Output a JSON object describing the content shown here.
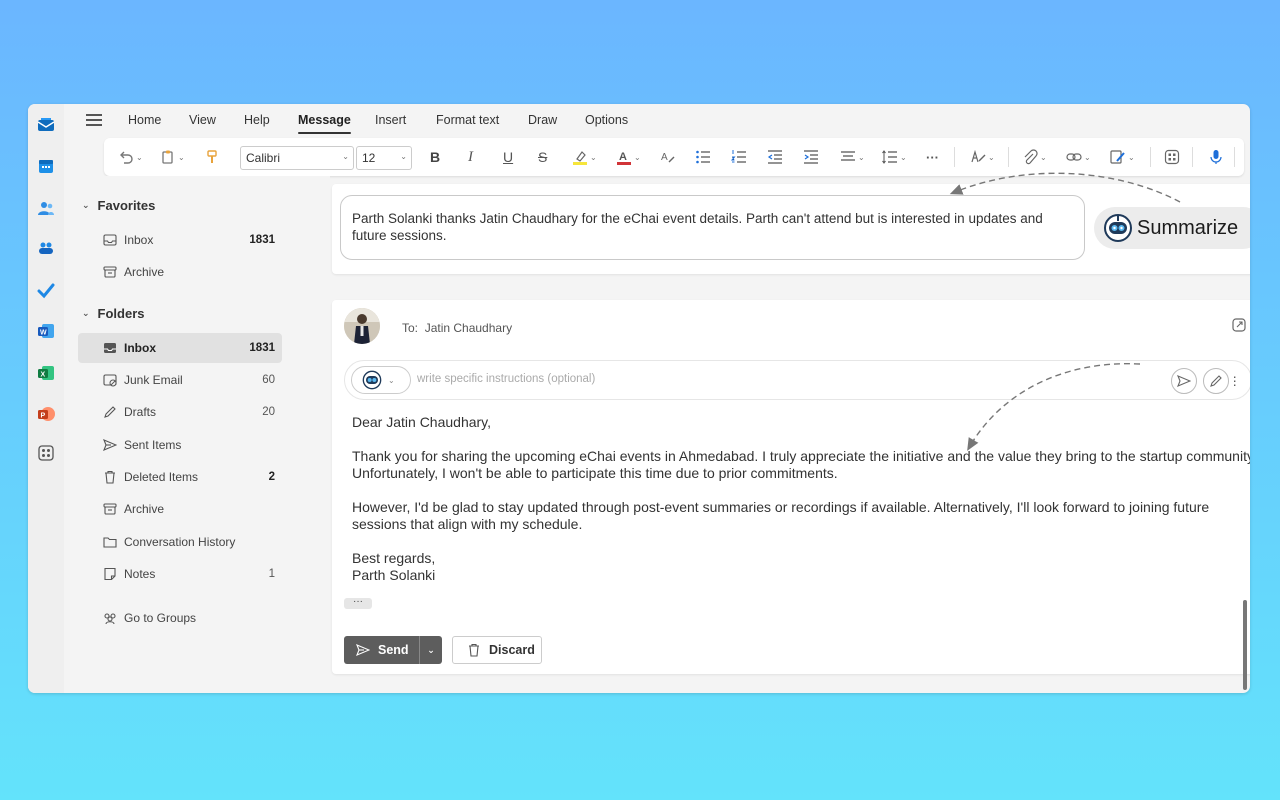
{
  "menu": {
    "tabs": [
      "Home",
      "View",
      "Help",
      "Message",
      "Insert",
      "Format text",
      "Draw",
      "Options"
    ],
    "active_tab": "Message"
  },
  "ribbon": {
    "font_name": "Calibri",
    "font_size": "12",
    "bold": "B",
    "italic": "I",
    "underline": "U",
    "strikethrough": "S",
    "more": "···"
  },
  "nav": {
    "favorites_label": "Favorites",
    "favorites": [
      {
        "label": "Inbox",
        "count": "1831",
        "icon": "inbox-icon"
      },
      {
        "label": "Archive",
        "count": "",
        "icon": "archive-icon"
      }
    ],
    "folders_label": "Folders",
    "folders": [
      {
        "label": "Inbox",
        "count": "1831",
        "icon": "inbox-icon",
        "selected": true
      },
      {
        "label": "Junk Email",
        "count": "60",
        "icon": "junk-icon"
      },
      {
        "label": "Drafts",
        "count": "20",
        "icon": "drafts-icon"
      },
      {
        "label": "Sent Items",
        "count": "",
        "icon": "send-icon"
      },
      {
        "label": "Deleted Items",
        "count": "2",
        "icon": "trash-icon"
      },
      {
        "label": "Archive",
        "count": "",
        "icon": "archive-icon"
      },
      {
        "label": "Conversation History",
        "count": "",
        "icon": "folder-icon"
      },
      {
        "label": "Notes",
        "count": "1",
        "icon": "notes-icon"
      }
    ],
    "groups_label": "Go to Groups"
  },
  "summary": {
    "text": "Parth Solanki thanks Jatin Chaudhary for the eChai event details. Parth can't attend but is interested in updates and future sessions.",
    "button_label": "Summarize"
  },
  "draft": {
    "to_label": "To:",
    "to_name": "Jatin Chaudhary",
    "instructions_placeholder": "write specific instructions (optional)",
    "greeting": "Dear Jatin Chaudhary,",
    "paragraph1": "Thank you for sharing the upcoming eChai events in Ahmedabad. I truly appreciate the initiative and the value they bring to the startup community. Unfortunately, I won't be able to participate this time due to prior commitments.",
    "paragraph2": "However, I'd be glad to stay updated through post-event summaries or recordings if available. Alternatively, I'll look forward to joining future sessions that align with my schedule.",
    "signoff": "Best regards,",
    "signature": "Parth Solanki",
    "more_label": "···",
    "send_label": "Send",
    "discard_label": "Discard"
  },
  "colors": {
    "accent": "#0f6cbd",
    "send_bg": "#5d5d5d",
    "page_top": "#6bb6ff",
    "page_bottom": "#63e3fb"
  }
}
